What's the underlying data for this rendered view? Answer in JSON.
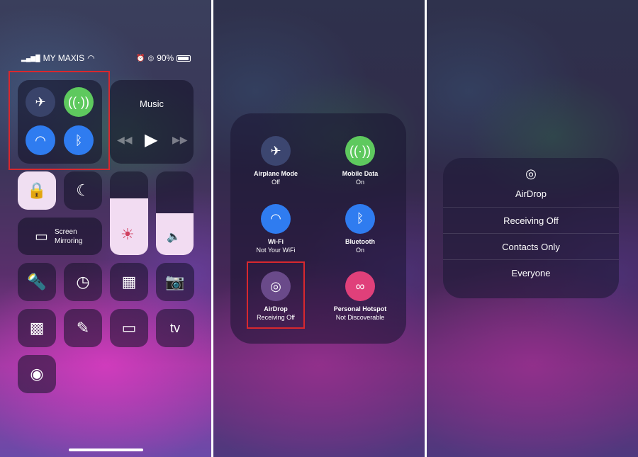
{
  "panel1": {
    "status": {
      "carrier": "MY MAXIS",
      "battery": "90%",
      "battery_level": 0.9
    },
    "music": {
      "title": "Music"
    },
    "brightness_level": 0.68,
    "volume_level": 0.5,
    "screen_mirroring": {
      "line1": "Screen",
      "line2": "Mirroring"
    },
    "appletv": "tv"
  },
  "panel2": {
    "items": [
      {
        "label": "Airplane Mode",
        "status": "Off",
        "icon": "airplane-icon",
        "color": "#3c4670"
      },
      {
        "label": "Mobile Data",
        "status": "On",
        "icon": "antenna-icon",
        "color": "#5ec95e"
      },
      {
        "label": "Wi-Fi",
        "status": "Not Your WiFi",
        "icon": "wifi-icon",
        "color": "#2f7cf0"
      },
      {
        "label": "Bluetooth",
        "status": "On",
        "icon": "bluetooth-icon",
        "color": "#2f7cf0"
      },
      {
        "label": "AirDrop",
        "status": "Receiving Off",
        "icon": "airdrop-icon",
        "color": "#6a4a8a"
      },
      {
        "label": "Personal Hotspot",
        "status": "Not Discoverable",
        "icon": "hotspot-icon",
        "color": "#e0407a"
      }
    ]
  },
  "panel3": {
    "title": "AirDrop",
    "options": [
      "Receiving Off",
      "Contacts Only",
      "Everyone"
    ]
  },
  "highlight_color": "#d8282e"
}
